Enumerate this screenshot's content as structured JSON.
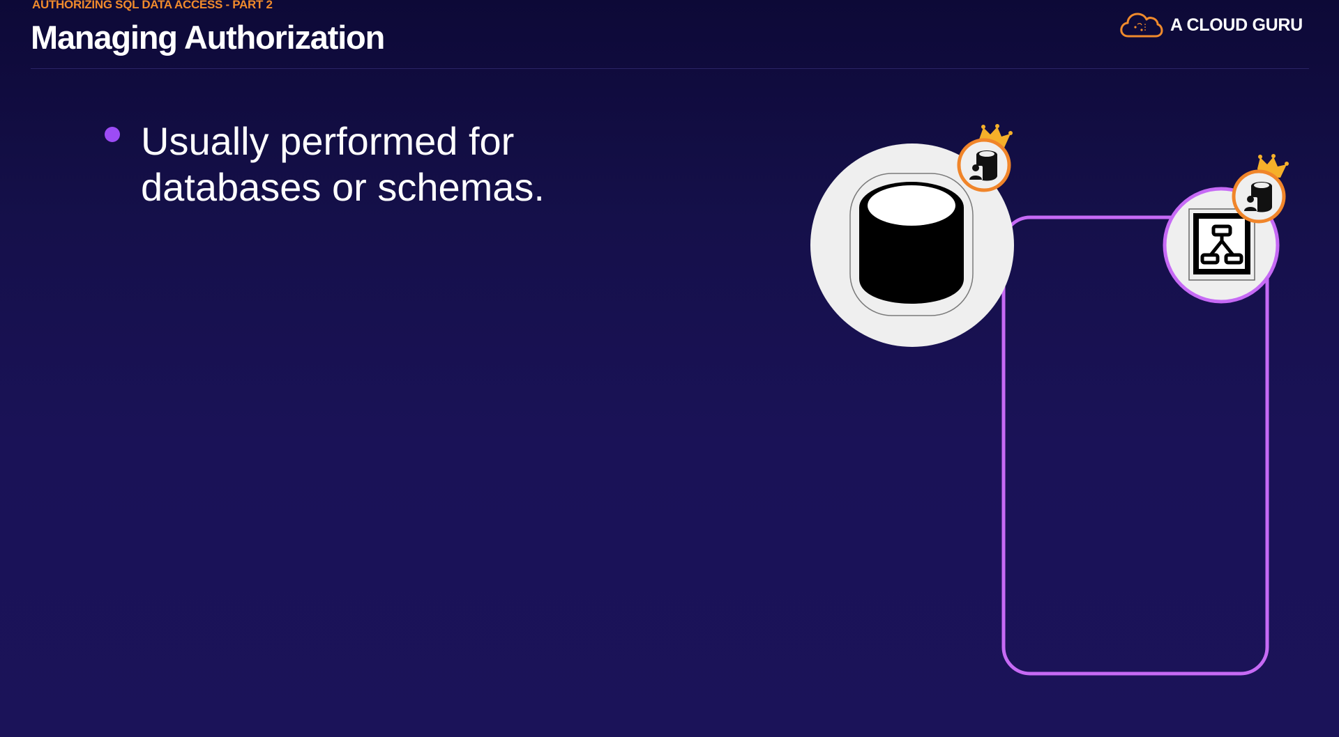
{
  "header": {
    "kicker": "AUTHORIZING SQL DATA ACCESS - PART 2",
    "title": "Managing Authorization"
  },
  "brand": {
    "logo_icon": "cloud-logo-icon",
    "name": "A CLOUD GURU"
  },
  "bullets": [
    {
      "text": "Usually performed for databases or schemas."
    }
  ],
  "diagram": {
    "database_icon": "database-cylinder-icon",
    "schema_icon": "schema-hierarchy-icon",
    "owner_badge_icon": "crowned-db-owner-icon",
    "colors": {
      "accent_purple": "#c66af5",
      "badge_orange": "#f0852a",
      "crown_gold": "#f5b02a",
      "node_fill": "#efefef"
    }
  },
  "colors": {
    "background_top": "#0d0937",
    "background_bottom": "#1b1359",
    "kicker": "#f08a2c",
    "bullet": "#9c4cf5"
  }
}
